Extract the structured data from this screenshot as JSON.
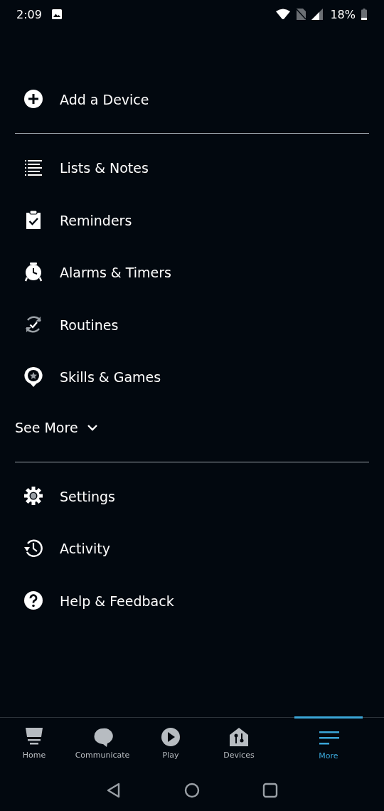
{
  "status_bar": {
    "time": "2:09",
    "battery": "18%"
  },
  "menu": {
    "sections": [
      {
        "items": [
          {
            "label": "Add a Device"
          }
        ]
      },
      {
        "items": [
          {
            "label": "Lists & Notes"
          },
          {
            "label": "Reminders"
          },
          {
            "label": "Alarms & Timers"
          },
          {
            "label": "Routines"
          },
          {
            "label": "Skills & Games"
          }
        ],
        "see_more": {
          "label": "See More",
          "expanded": false
        }
      },
      {
        "items": [
          {
            "label": "Settings"
          },
          {
            "label": "Activity"
          },
          {
            "label": "Help & Feedback"
          }
        ]
      }
    ]
  },
  "bottom_nav": [
    {
      "label": "Home",
      "selected": false
    },
    {
      "label": "Communicate",
      "selected": false
    },
    {
      "label": "Play",
      "selected": false
    },
    {
      "label": "Devices",
      "selected": false
    },
    {
      "label": "More",
      "selected": true
    }
  ]
}
